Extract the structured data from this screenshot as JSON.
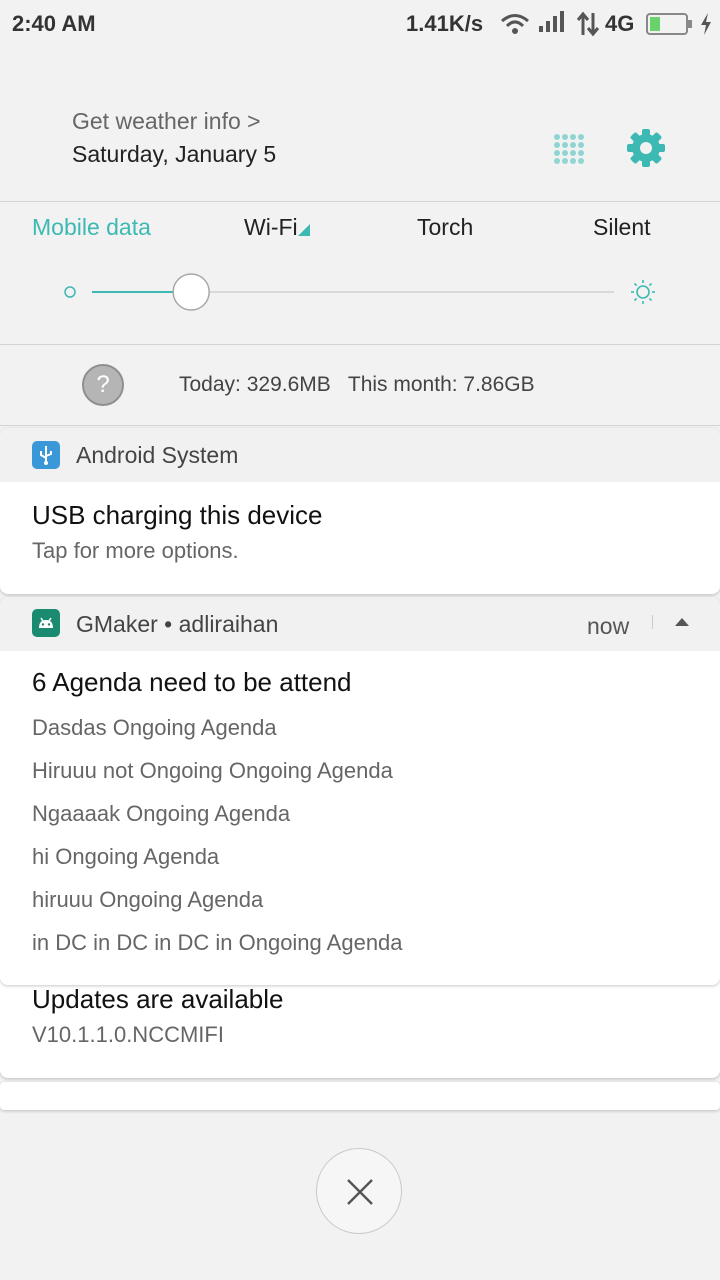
{
  "status_bar": {
    "time": "2:40 AM",
    "speed": "1.41K/s",
    "network": "4G",
    "battery_level": 0.3
  },
  "header": {
    "weather_link": "Get weather info >",
    "date": "Saturday, January 5"
  },
  "toggles": {
    "mobile_data": "Mobile data",
    "wifi": "Wi-Fi",
    "torch": "Torch",
    "silent": "Silent"
  },
  "brightness": {
    "level": 0.19
  },
  "data_usage": {
    "help_label": "?",
    "text": "Today: 329.6MB   This month: 7.86GB"
  },
  "notifications": {
    "android_system": {
      "app": "Android System",
      "title": "USB charging this device",
      "text": "Tap for more options."
    },
    "gmaker": {
      "app": "GMaker • adliraihan",
      "time": "now",
      "title": "6 Agenda need to be attend",
      "lines": [
        "Dasdas Ongoing Agenda",
        "Hiruuu not Ongoing Ongoing Agenda",
        "Ngaaaak Ongoing Agenda",
        "hi Ongoing Agenda",
        "hiruuu Ongoing Agenda",
        "in DC in DC in DC in Ongoing Agenda"
      ]
    },
    "updates": {
      "title": "Updates are available",
      "text": "V10.1.1.0.NCCMIFI"
    }
  },
  "colors": {
    "accent": "#3db9b4",
    "android_system_icon": "#3a97d8",
    "gmaker_icon": "#1a8a70"
  }
}
